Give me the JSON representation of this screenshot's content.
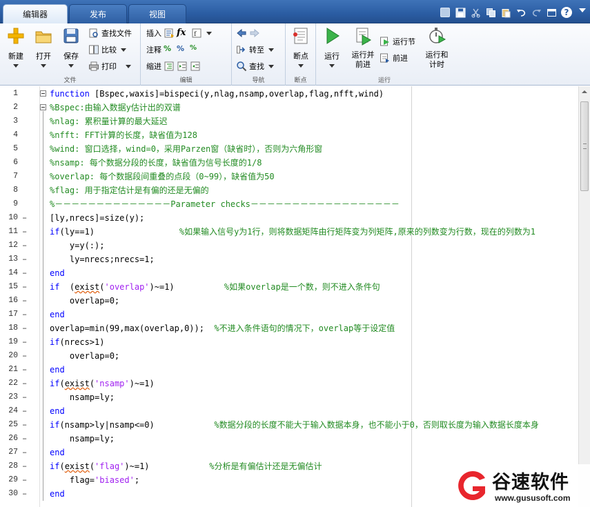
{
  "tabs": [
    {
      "label": "编辑器",
      "active": true
    },
    {
      "label": "发布",
      "active": false
    },
    {
      "label": "视图",
      "active": false
    }
  ],
  "quick_access": [
    "new-doc-icon",
    "save-icon",
    "cut-icon",
    "copy-icon",
    "paste-icon",
    "undo-icon",
    "redo-icon",
    "window-icon",
    "help-icon"
  ],
  "ribbon": {
    "file": {
      "label": "文件",
      "new": "新建",
      "open": "打开",
      "save": "保存",
      "find_files": "查找文件",
      "compare": "比较",
      "print": "打印"
    },
    "edit": {
      "label": "编辑",
      "insert": "插入",
      "comment": "注释",
      "indent": "缩进",
      "fx": "fx"
    },
    "navigate": {
      "label": "导航",
      "goto": "转至",
      "find": "查找"
    },
    "breakpoints": {
      "label": "断点",
      "breakpoints": "断点"
    },
    "run": {
      "label": "运行",
      "run": "运行",
      "run_advance_1": "运行并",
      "run_advance_2": "前进",
      "run_section": "运行节",
      "advance": "前进",
      "run_time_1": "运行和",
      "run_time_2": "计时"
    }
  },
  "code_lines": [
    {
      "n": "1",
      "dash": "",
      "fold": "box",
      "segs": [
        [
          "kw",
          "function "
        ],
        [
          "",
          "[Bspec,waxis]=bispeci(y,nlag,nsamp,overlap,flag,nfft,wind)"
        ]
      ]
    },
    {
      "n": "2",
      "dash": "",
      "fold": "box",
      "segs": [
        [
          "cm",
          "%Bspec:由输入数据y估计出的双谱"
        ]
      ]
    },
    {
      "n": "3",
      "dash": "",
      "fold": "",
      "segs": [
        [
          "cm",
          "%nlag: 累积量计算的最大延迟"
        ]
      ]
    },
    {
      "n": "4",
      "dash": "",
      "fold": "",
      "segs": [
        [
          "cm",
          "%nfft: FFT计算的长度，缺省值为128"
        ]
      ]
    },
    {
      "n": "5",
      "dash": "",
      "fold": "",
      "segs": [
        [
          "cm",
          "%wind: 窗口选择，wind=0，采用Parzen窗（缺省时），否则为六角形窗"
        ]
      ]
    },
    {
      "n": "6",
      "dash": "",
      "fold": "",
      "segs": [
        [
          "cm",
          "%nsamp: 每个数据分段的长度，缺省值为信号长度的1/8"
        ]
      ]
    },
    {
      "n": "7",
      "dash": "",
      "fold": "",
      "segs": [
        [
          "cm",
          "%overlap: 每个数据段间重叠的点段（0~99），缺省值为50"
        ]
      ]
    },
    {
      "n": "8",
      "dash": "",
      "fold": "",
      "segs": [
        [
          "cm",
          "%flag: 用于指定估计是有偏的还是无偏的"
        ]
      ]
    },
    {
      "n": "9",
      "dash": "",
      "fold": "",
      "segs": [
        [
          "cm",
          "%－－－－－－－－－－－－－－Parameter checks－－－－－－－－－－－－－－－－－－"
        ]
      ]
    },
    {
      "n": "10",
      "dash": "–",
      "fold": "",
      "segs": [
        [
          "",
          "[ly,nrecs]=size(y);"
        ]
      ]
    },
    {
      "n": "11",
      "dash": "–",
      "fold": "",
      "segs": [
        [
          "kw",
          "if"
        ],
        [
          "",
          "(ly==1)                 "
        ],
        [
          "cm",
          "%如果输入信号y为1行，则将数据矩阵由行矩阵变为列矩阵,原来的列数变为行数，现在的列数为1"
        ]
      ]
    },
    {
      "n": "12",
      "dash": "–",
      "fold": "",
      "segs": [
        [
          "",
          "    y=y(:);"
        ]
      ]
    },
    {
      "n": "13",
      "dash": "–",
      "fold": "",
      "segs": [
        [
          "",
          "    ly=nrecs;nrecs=1;"
        ]
      ]
    },
    {
      "n": "14",
      "dash": "–",
      "fold": "",
      "segs": [
        [
          "kw",
          "end"
        ]
      ]
    },
    {
      "n": "15",
      "dash": "–",
      "fold": "",
      "segs": [
        [
          "kw",
          "if"
        ],
        [
          "",
          "  ("
        ],
        [
          "wv",
          "exist"
        ],
        [
          "",
          "("
        ],
        [
          "st",
          "'overlap'"
        ],
        [
          "",
          ")~=1)          "
        ],
        [
          "cm",
          "%如果overlap是一个数，则不进入条件句"
        ]
      ]
    },
    {
      "n": "16",
      "dash": "–",
      "fold": "",
      "segs": [
        [
          "",
          "    overlap=0;"
        ]
      ]
    },
    {
      "n": "17",
      "dash": "–",
      "fold": "",
      "segs": [
        [
          "kw",
          "end"
        ]
      ]
    },
    {
      "n": "18",
      "dash": "–",
      "fold": "",
      "segs": [
        [
          "",
          "overlap=min(99,max(overlap,0));  "
        ],
        [
          "cm",
          "%不进入条件语句的情况下，overlap等于设定值"
        ]
      ]
    },
    {
      "n": "19",
      "dash": "–",
      "fold": "",
      "segs": [
        [
          "kw",
          "if"
        ],
        [
          "",
          "(nrecs>1)"
        ]
      ]
    },
    {
      "n": "20",
      "dash": "–",
      "fold": "",
      "segs": [
        [
          "",
          "    overlap=0;"
        ]
      ]
    },
    {
      "n": "21",
      "dash": "–",
      "fold": "",
      "segs": [
        [
          "kw",
          "end"
        ]
      ]
    },
    {
      "n": "22",
      "dash": "–",
      "fold": "",
      "segs": [
        [
          "kw",
          "if"
        ],
        [
          "",
          "("
        ],
        [
          "wv",
          "exist"
        ],
        [
          "",
          "("
        ],
        [
          "st",
          "'nsamp'"
        ],
        [
          "",
          ")~=1)"
        ]
      ]
    },
    {
      "n": "23",
      "dash": "–",
      "fold": "",
      "segs": [
        [
          "",
          "    nsamp=ly;"
        ]
      ]
    },
    {
      "n": "24",
      "dash": "–",
      "fold": "",
      "segs": [
        [
          "kw",
          "end"
        ]
      ]
    },
    {
      "n": "25",
      "dash": "–",
      "fold": "",
      "segs": [
        [
          "kw",
          "if"
        ],
        [
          "",
          "(nsamp>ly|nsamp<=0)            "
        ],
        [
          "cm",
          "%数据分段的长度不能大于输入数据本身，也不能小于0，否则取长度为输入数据长度本身"
        ]
      ]
    },
    {
      "n": "26",
      "dash": "–",
      "fold": "",
      "segs": [
        [
          "",
          "    nsamp=ly;"
        ]
      ]
    },
    {
      "n": "27",
      "dash": "–",
      "fold": "",
      "segs": [
        [
          "kw",
          "end"
        ]
      ]
    },
    {
      "n": "28",
      "dash": "–",
      "fold": "",
      "segs": [
        [
          "kw",
          "if"
        ],
        [
          "",
          "("
        ],
        [
          "wv",
          "exist"
        ],
        [
          "",
          "("
        ],
        [
          "st",
          "'flag'"
        ],
        [
          "",
          ")~=1)            "
        ],
        [
          "cm",
          "%分析是有偏估计还是无偏估计"
        ]
      ]
    },
    {
      "n": "29",
      "dash": "–",
      "fold": "",
      "segs": [
        [
          "",
          "    flag="
        ],
        [
          "st",
          "'biased'"
        ],
        [
          "",
          ";"
        ]
      ]
    },
    {
      "n": "30",
      "dash": "–",
      "fold": "",
      "segs": [
        [
          "kw",
          "end"
        ]
      ]
    }
  ],
  "watermark": {
    "brand": "谷速软件",
    "url": "www.gususoft.com",
    "logo_color": "#e8262d"
  },
  "colors": {
    "keyword": "#0000ff",
    "comment": "#228b22",
    "string": "#a020f0",
    "tabbar": "#2b5da3"
  }
}
